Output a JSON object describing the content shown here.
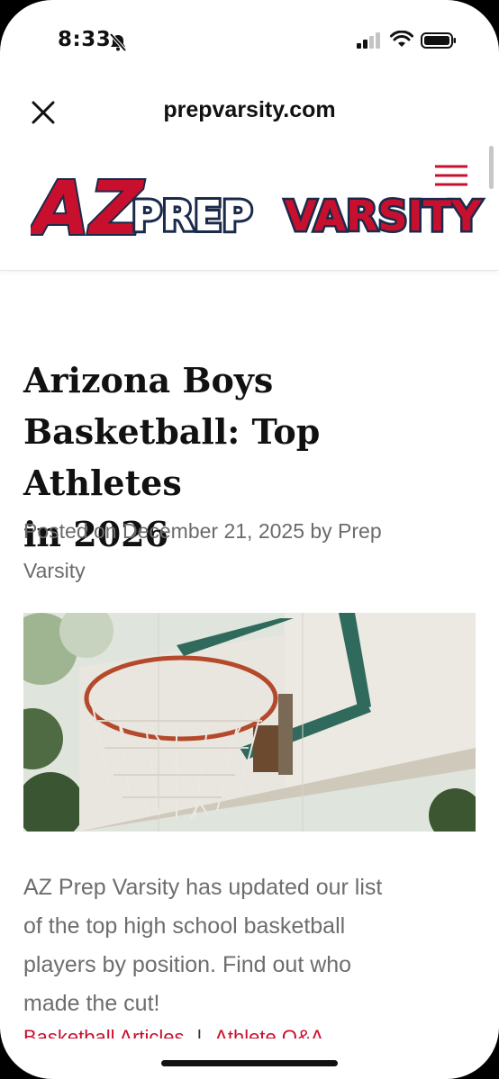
{
  "status_bar": {
    "time": "8:33"
  },
  "browser": {
    "url": "prepvarsity.com"
  },
  "logo": {
    "az": "AZ",
    "prep": "PREP",
    "varsity": "VARSITY"
  },
  "article": {
    "title_lines": [
      "Arizona Boys",
      "Basketball: Top Athletes",
      "in 2026"
    ],
    "meta_lines": [
      "Posted on December 21, 2025 by Prep",
      "Varsity"
    ],
    "excerpt_lines": [
      "AZ Prep Varsity has updated our list",
      "of the top high school basketball",
      "players by position. Find out who",
      "made the cut!"
    ],
    "categories": [
      "Basketball Articles",
      "Athlete Q&A"
    ]
  },
  "colors": {
    "brand_red": "#c8102e",
    "brand_navy": "#1a2a4a",
    "text": "#111111",
    "muted": "#6b6b6b"
  }
}
